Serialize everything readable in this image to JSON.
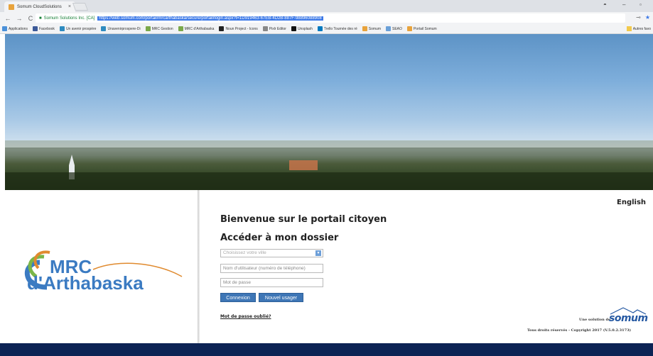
{
  "browser": {
    "tab_title": "Somum CloudSolutions",
    "tab_close": "×",
    "secure_label": "Somum Solutions Inc. [CA]",
    "url": "https://web.somum.com/portail/mrcarthabaska/secure/portail/login.aspx?t=1D919463-67EB-4D2B-887F-98896088908"
  },
  "bookmarks": [
    {
      "label": "Applications",
      "color": "#4a90d9"
    },
    {
      "label": "Facebook",
      "color": "#3b5998"
    },
    {
      "label": "Un avenir prospère",
      "color": "#2e8bc0"
    },
    {
      "label": "Unavenirprospere-Di",
      "color": "#2e8bc0"
    },
    {
      "label": "MRC Gestion",
      "color": "#7aa84a"
    },
    {
      "label": "MRC d'Arthabaska",
      "color": "#7aa84a"
    },
    {
      "label": "Noun Project - Icons",
      "color": "#222222"
    },
    {
      "label": "Pixlr Editor",
      "color": "#888888"
    },
    {
      "label": "Unsplash",
      "color": "#111111"
    },
    {
      "label": "Trello Tournée des ré",
      "color": "#0079bf"
    },
    {
      "label": "Somum",
      "color": "#e8a33c"
    },
    {
      "label": "SEAO",
      "color": "#6aa0d8"
    },
    {
      "label": "Portail Somum",
      "color": "#e8a33c"
    }
  ],
  "bookmarks_other": "Autres favo",
  "page": {
    "language_link": "English",
    "welcome": "Bienvenue sur le portail citoyen",
    "section_title": "Accéder à mon dossier",
    "city_select_placeholder": "Choisissez votre ville",
    "username_placeholder": "Nom d'utilisateur (numéro de téléphone)",
    "password_placeholder": "Mot de passe",
    "login_button": "Connexion",
    "new_user_button": "Nouvel usager",
    "forgot_password": "Mot de passe oublié?",
    "brand_prefix": "Une solution de",
    "brand_name": "somum",
    "copyright": "Tous droits réservés - Copyright 2017 (V.5.0.2.3173)"
  },
  "logo": {
    "line1": "MRC",
    "line2": "d'Arthabaska"
  }
}
